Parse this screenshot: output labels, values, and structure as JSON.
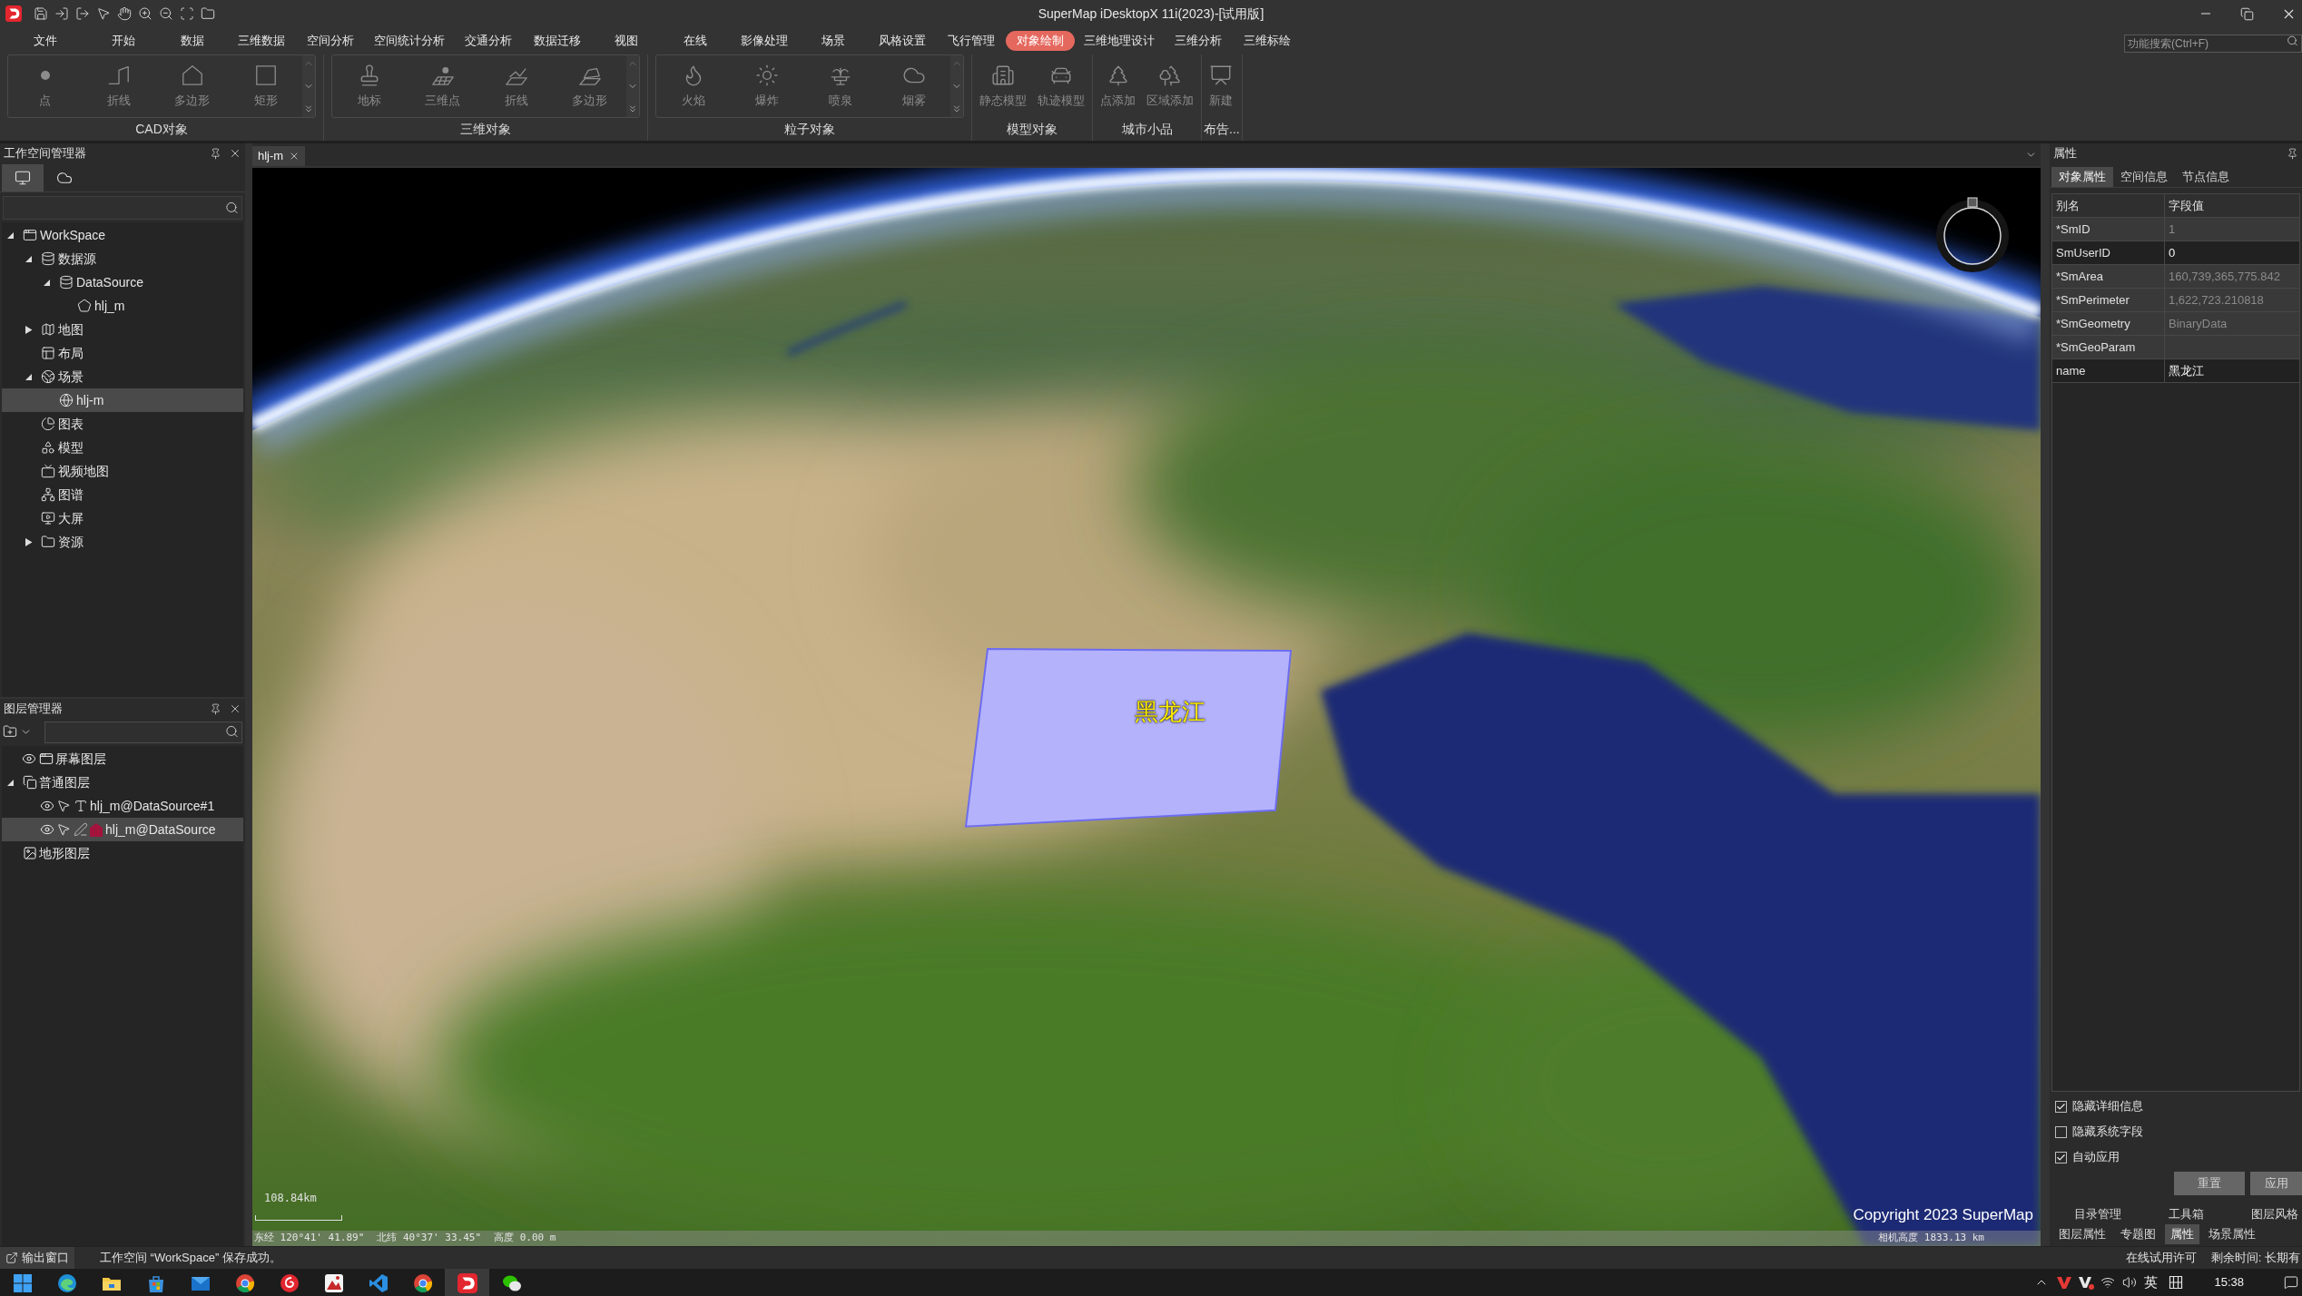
{
  "window": {
    "title": "SuperMap iDesktopX 11i(2023)-[试用版]"
  },
  "menu_tabs": [
    {
      "label": "文件",
      "selected": false
    },
    {
      "label": "开始",
      "selected": false
    },
    {
      "label": "数据",
      "selected": false
    },
    {
      "label": "三维数据",
      "selected": false
    },
    {
      "label": "空间分析",
      "selected": false
    },
    {
      "label": "空间统计分析",
      "selected": false
    },
    {
      "label": "交通分析",
      "selected": false
    },
    {
      "label": "数据迁移",
      "selected": false
    },
    {
      "label": "视图",
      "selected": false
    },
    {
      "label": "在线",
      "selected": false
    },
    {
      "label": "影像处理",
      "selected": false
    },
    {
      "label": "场景",
      "selected": false
    },
    {
      "label": "风格设置",
      "selected": false
    },
    {
      "label": "飞行管理",
      "selected": false
    },
    {
      "label": "对象绘制",
      "selected": true
    },
    {
      "label": "三维地理设计",
      "selected": false
    },
    {
      "label": "三维分析",
      "selected": false
    },
    {
      "label": "三维标绘",
      "selected": false
    }
  ],
  "search": {
    "placeholder": "功能搜索(Ctrl+F)"
  },
  "ribbon_groups": [
    {
      "kind": "gallery",
      "title": "CAD对象",
      "buttons": [
        {
          "kind": "point",
          "label": "点",
          "disabled": true
        },
        {
          "kind": "polyline",
          "label": "折线",
          "disabled": true
        },
        {
          "kind": "polygon",
          "label": "多边形",
          "disabled": true
        },
        {
          "kind": "rectangle",
          "label": "矩形",
          "disabled": true
        }
      ]
    },
    {
      "kind": "gallery",
      "title": "三维对象",
      "buttons": [
        {
          "kind": "landmark",
          "label": "地标",
          "disabled": true
        },
        {
          "kind": "point3d",
          "label": "三维点",
          "disabled": true
        },
        {
          "kind": "polyline3d",
          "label": "折线",
          "disabled": true
        },
        {
          "kind": "polygon3d",
          "label": "多边形",
          "disabled": true
        }
      ]
    },
    {
      "kind": "gallery",
      "title": "粒子对象",
      "buttons": [
        {
          "kind": "fire",
          "label": "火焰",
          "disabled": true
        },
        {
          "kind": "explosion",
          "label": "爆炸",
          "disabled": true
        },
        {
          "kind": "fountain",
          "label": "喷泉",
          "disabled": true
        },
        {
          "kind": "smoke",
          "label": "烟雾",
          "disabled": true
        }
      ]
    },
    {
      "kind": "plain",
      "title": "模型对象",
      "buttons": [
        {
          "kind": "staticmodel",
          "label": "静态模型",
          "disabled": true
        },
        {
          "kind": "trackmodel",
          "label": "轨迹模型",
          "disabled": true
        }
      ]
    },
    {
      "kind": "plain",
      "title": "城市小品",
      "buttons": [
        {
          "kind": "pointadd",
          "label": "点添加",
          "disabled": true
        },
        {
          "kind": "regionadd",
          "label": "区域添加",
          "disabled": true
        }
      ]
    },
    {
      "kind": "plain",
      "title": "布告...",
      "buttons": [
        {
          "kind": "billboard",
          "label": "新建",
          "disabled": true
        }
      ]
    }
  ],
  "workspace_manager": {
    "title": "工作空间管理器",
    "tabs": [
      {
        "kind": "local",
        "selected": true
      },
      {
        "kind": "online",
        "selected": false
      }
    ],
    "tree": [
      {
        "kind": "workspace",
        "label": "WorkSpace",
        "expanded": true,
        "selected": false,
        "children": [
          {
            "kind": "datasources",
            "label": "数据源",
            "expanded": true,
            "selected": false,
            "children": [
              {
                "kind": "datasource",
                "label": "DataSource",
                "expanded": true,
                "selected": false,
                "children": [
                  {
                    "kind": "region",
                    "label": "hlj_m",
                    "selected": false
                  }
                ]
              }
            ]
          },
          {
            "kind": "maps",
            "label": "地图",
            "expanded": false,
            "selected": false
          },
          {
            "kind": "layouts",
            "label": "布局",
            "selected": false
          },
          {
            "kind": "scenes",
            "label": "场景",
            "expanded": true,
            "selected": false,
            "children": [
              {
                "kind": "scene",
                "label": "hlj-m",
                "selected": true
              }
            ]
          },
          {
            "kind": "charts",
            "label": "图表",
            "selected": false
          },
          {
            "kind": "models",
            "label": "模型",
            "selected": false
          },
          {
            "kind": "videomaps",
            "label": "视频地图",
            "selected": false
          },
          {
            "kind": "graphs",
            "label": "图谱",
            "selected": false
          },
          {
            "kind": "screens",
            "label": "大屏",
            "selected": false
          },
          {
            "kind": "resources",
            "label": "资源",
            "expanded": false,
            "selected": false
          }
        ]
      }
    ]
  },
  "layer_manager": {
    "title": "图层管理器",
    "layers": [
      {
        "kind": "screen",
        "label": "屏幕图层",
        "visible": true,
        "selected": false
      },
      {
        "kind": "group",
        "label": "普通图层",
        "expanded": true,
        "selected": false,
        "children": [
          {
            "kind": "label",
            "label": "hlj_m@DataSource#1",
            "visible": true,
            "editable": false,
            "selected": false
          },
          {
            "kind": "region",
            "label": "hlj_m@DataSource",
            "visible": true,
            "editable": true,
            "selected": true
          }
        ]
      },
      {
        "kind": "terrain",
        "label": "地形图层",
        "selected": false
      }
    ]
  },
  "document_tabs": [
    {
      "label": "hlj-m",
      "selected": true
    }
  ],
  "scene": {
    "region_label": "黑龙江",
    "scale": "108.84km",
    "copyright": "Copyright 2023 SuperMap",
    "coordinates": [
      "东经 120°41' 41.89\"",
      "北纬 40°37' 33.45\"",
      "高度 0.00 m"
    ],
    "camera_height": "相机高度 1833.13 km"
  },
  "properties": {
    "title": "属性",
    "tabs": [
      {
        "label": "对象属性",
        "selected": true
      },
      {
        "label": "空间信息",
        "selected": false
      },
      {
        "label": "节点信息",
        "selected": false
      }
    ],
    "columns": [
      "别名",
      "字段值"
    ],
    "rows": [
      {
        "field": "*SmID",
        "value": "1",
        "readonly": true
      },
      {
        "field": "SmUserID",
        "value": "0",
        "readonly": false
      },
      {
        "field": "*SmArea",
        "value": "160,739,365,775.842",
        "readonly": true
      },
      {
        "field": "*SmPerimeter",
        "value": "1,622,723.210818",
        "readonly": true
      },
      {
        "field": "*SmGeometry",
        "value": "BinaryData",
        "readonly": true
      },
      {
        "field": "*SmGeoParam",
        "readonly": true
      },
      {
        "field": "name",
        "value": "黑龙江",
        "readonly": false
      }
    ],
    "options": [
      {
        "label": "隐藏详细信息",
        "checked": true
      },
      {
        "label": "隐藏系统字段",
        "checked": false
      },
      {
        "label": "自动应用",
        "checked": true
      }
    ],
    "buttons": [
      "重置",
      "应用"
    ],
    "dock_tab_rows": [
      {
        "tabs": [
          {
            "label": "目录管理",
            "selected": false
          },
          {
            "label": "工具箱",
            "selected": false
          },
          {
            "label": "图层风格",
            "selected": false
          }
        ]
      },
      {
        "tabs": [
          {
            "label": "图层属性",
            "selected": false
          },
          {
            "label": "专题图",
            "selected": false
          },
          {
            "label": "属性",
            "selected": true
          },
          {
            "label": "场景属性",
            "selected": false
          }
        ]
      }
    ]
  },
  "status_bar": {
    "output_tab": "输出窗口",
    "message": "工作空间 “WorkSpace” 保存成功。",
    "license": "在线试用许可",
    "remaining": "剩余时间: 长期有"
  },
  "taskbar": {
    "apps": [
      {
        "kind": "start",
        "selected": false
      },
      {
        "kind": "swirl",
        "selected": false
      },
      {
        "kind": "folder",
        "selected": false
      },
      {
        "kind": "bag",
        "selected": false
      },
      {
        "kind": "mail",
        "selected": false
      },
      {
        "kind": "tricolor",
        "selected": false
      },
      {
        "kind": "disc",
        "selected": false
      },
      {
        "kind": "tile",
        "selected": false
      },
      {
        "kind": "ribbon",
        "selected": false
      },
      {
        "kind": "tricolor",
        "selected": false
      },
      {
        "kind": "app",
        "selected": true
      },
      {
        "kind": "chat",
        "selected": false
      }
    ],
    "input_language": "英",
    "time": "15:38"
  }
}
